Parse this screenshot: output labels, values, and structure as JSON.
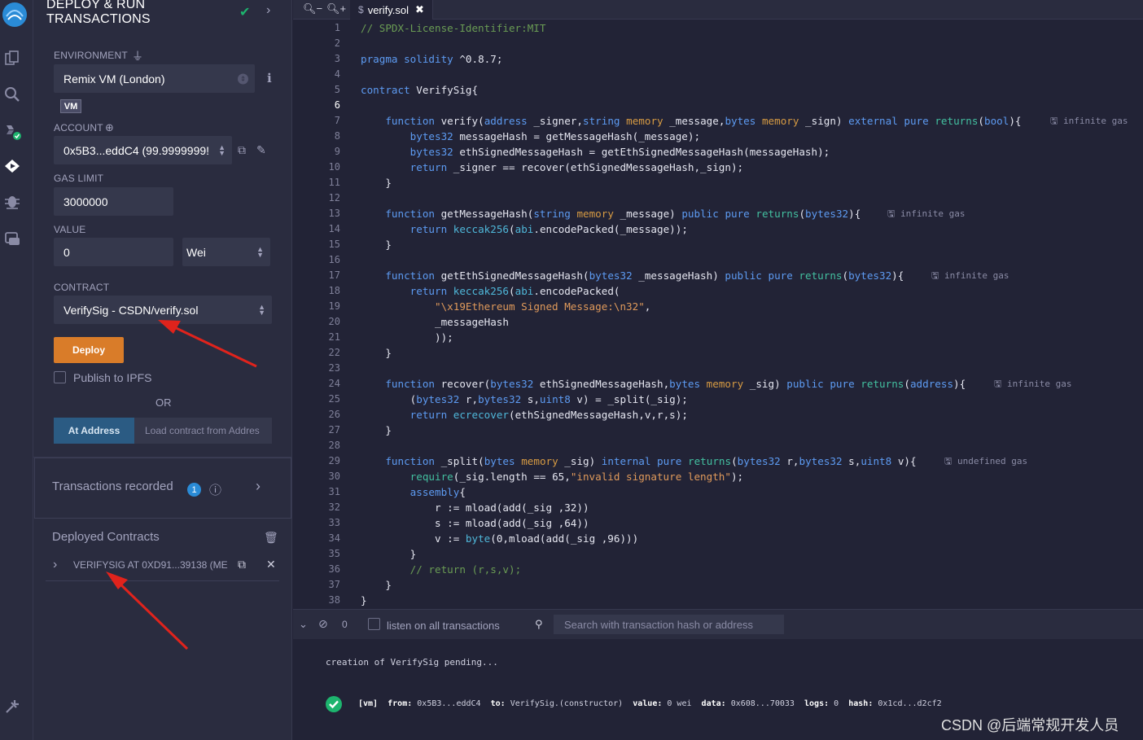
{
  "plugin": {
    "title_line1": "DEPLOY & RUN",
    "title_line2": "TRANSACTIONS"
  },
  "environment": {
    "label": "ENVIRONMENT",
    "value": "Remix VM (London)",
    "badge": "VM"
  },
  "account": {
    "label": "ACCOUNT",
    "value": "0x5B3...eddC4 (99.9999999!"
  },
  "gas_limit": {
    "label": "GAS LIMIT",
    "value": "3000000"
  },
  "value": {
    "label": "VALUE",
    "amount": "0",
    "unit": "Wei"
  },
  "contract": {
    "label": "CONTRACT",
    "value": "VerifySig - CSDN/verify.sol"
  },
  "deploy": {
    "button": "Deploy",
    "publish_ipfs": "Publish to IPFS",
    "or": "OR",
    "at_address_button": "At Address",
    "at_address_placeholder": "Load contract from Addres"
  },
  "transactions": {
    "label": "Transactions recorded",
    "count": "1"
  },
  "deployed": {
    "label": "Deployed Contracts",
    "instance": "VERIFYSIG AT 0XD91...39138 (ME"
  },
  "editor": {
    "tab": "verify.sol",
    "lines": [
      "// SPDX-License-Identifier:MIT",
      "",
      "pragma solidity ^0.8.7;",
      "",
      "contract VerifySig{",
      "",
      "    function verify(address _signer,string memory _message,bytes memory _sign) external pure returns(bool){",
      "        bytes32 messageHash = getMessageHash(_message);",
      "        bytes32 ethSignedMessageHash = getEthSignedMessageHash(messageHash);",
      "        return _signer == recover(ethSignedMessageHash,_sign);",
      "    }",
      "",
      "    function getMessageHash(string memory _message) public pure returns(bytes32){",
      "        return keccak256(abi.encodePacked(_message));",
      "    }",
      "",
      "    function getEthSignedMessageHash(bytes32 _messageHash) public pure returns(bytes32){",
      "        return keccak256(abi.encodePacked(",
      "            \"\\x19Ethereum Signed Message:\\n32\",",
      "            _messageHash",
      "            ));",
      "    }",
      "",
      "    function recover(bytes32 ethSignedMessageHash,bytes memory _sig) public pure returns(address){",
      "        (bytes32 r,bytes32 s,uint8 v) = _split(_sig);",
      "        return ecrecover(ethSignedMessageHash,v,r,s);",
      "    }",
      "",
      "    function _split(bytes memory _sig) internal pure returns(bytes32 r,bytes32 s,uint8 v){",
      "        require(_sig.length == 65,\"invalid signature length\");",
      "        assembly{",
      "            r := mload(add(_sig ,32))",
      "            s := mload(add(_sig ,64))",
      "            v := byte(0,mload(add(_sig ,96)))",
      "        }",
      "        // return (r,s,v);",
      "    }",
      "}"
    ],
    "gas_hints": [
      {
        "line": 7,
        "text": "infinite gas"
      },
      {
        "line": 13,
        "text": "infinite gas"
      },
      {
        "line": 17,
        "text": "infinite gas"
      },
      {
        "line": 24,
        "text": "infinite gas"
      },
      {
        "line": 29,
        "text": "undefined gas"
      }
    ]
  },
  "terminal": {
    "count": "0",
    "listen_label": "listen on all transactions",
    "search_placeholder": "Search with transaction hash or address",
    "pending": "creation of VerifySig pending...",
    "tx": {
      "vm": "[vm]",
      "from_label": "from:",
      "from": "0x5B3...eddC4",
      "to_label": "to:",
      "to": "VerifySig.(constructor)",
      "value_label": "value:",
      "value": "0 wei",
      "data_label": "data:",
      "data": "0x608...70033",
      "logs_label": "logs:",
      "logs": "0",
      "hash_label": "hash:",
      "hash": "0x1cd...d2cf2"
    }
  },
  "watermark": "CSDN @后端常规开发人员",
  "colors": {
    "accent": "#d97c29",
    "at_address": "#2b5b83",
    "success": "#1db46e",
    "annotation_arrow": "#e0231c"
  }
}
